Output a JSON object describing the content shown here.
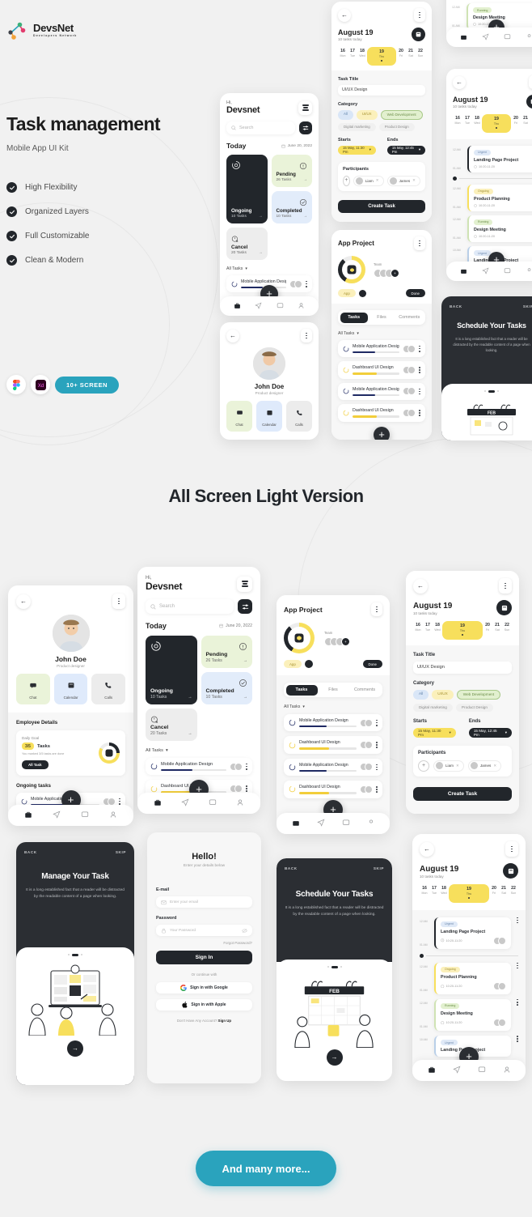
{
  "brand": {
    "name": "DevsNet",
    "tagline": "Developers Network"
  },
  "hero": {
    "title": "Task management",
    "subtitle": "Mobile App UI Kit",
    "features": [
      "High Flexibility",
      "Organized Layers",
      "Full Customizable",
      "Clean & Modern"
    ],
    "badges": {
      "figma": "Figma",
      "xd": "Xd",
      "screens": "10+ SCREEN"
    }
  },
  "section2": {
    "title": "All Screen Light Version"
  },
  "cta": {
    "label": "And many more..."
  },
  "home": {
    "greeting": "Hi,",
    "user": "Devsnet",
    "search_placeholder": "Search",
    "today_label": "Today",
    "today_date": "June 20, 2022",
    "stats": [
      {
        "name": "Ongoing",
        "count": "10 Tasks",
        "icon": "sync-icon"
      },
      {
        "name": "Pending",
        "count": "26 Tasks",
        "icon": "alert-icon"
      },
      {
        "name": "Completed",
        "count": "10 Tasks",
        "icon": "check-circle-icon"
      },
      {
        "name": "Cancel",
        "count": "20 Tasks",
        "icon": "clock-x-icon"
      }
    ],
    "all_tasks_label": "All Tasks",
    "tasks": [
      {
        "title": "Mobile Application Design",
        "progress": 48,
        "color": "#1f2a63"
      },
      {
        "title": "Dashboard UI Design",
        "progress": 52,
        "color": "#f2ce3b"
      }
    ]
  },
  "create_task": {
    "date": "August 19",
    "subtitle": "10 tasks today",
    "days": [
      {
        "n": "16",
        "w": "Mon"
      },
      {
        "n": "17",
        "w": "Tue"
      },
      {
        "n": "18",
        "w": "Wed"
      },
      {
        "n": "19",
        "w": "Thu"
      },
      {
        "n": "20",
        "w": "Fri"
      },
      {
        "n": "21",
        "w": "Sat"
      },
      {
        "n": "22",
        "w": "Sun"
      }
    ],
    "active_day_index": 3,
    "title_label": "Task Title",
    "title_value": "UI/UX Design",
    "category_label": "Category",
    "categories": [
      "All",
      "UI/UX",
      "Web Development",
      "Digital marketing",
      "Product Design"
    ],
    "starts_label": "Starts",
    "starts_value": "15 May, 11:30 Pm",
    "ends_label": "Ends",
    "ends_value": "15 May, 12:45 Pm",
    "participants_label": "Participants",
    "participants": [
      "Liam",
      "James"
    ],
    "submit": "Create Task"
  },
  "project": {
    "title": "App Project",
    "team_label": "Team",
    "team_more": "+",
    "tag": "App",
    "status": "Done",
    "tabs": [
      "Tasks",
      "Files",
      "Comments"
    ],
    "active_tab": 0,
    "all_tasks_label": "All Tasks",
    "tasks": [
      {
        "title": "Mobile Application Design",
        "progress": 48,
        "color": "#1f2a63"
      },
      {
        "title": "Dashboard UI Design",
        "progress": 52,
        "color": "#f2ce3b"
      },
      {
        "title": "Mobile Application Design",
        "progress": 48,
        "color": "#1f2a63"
      },
      {
        "title": "Dashboard UI Design",
        "progress": 52,
        "color": "#f2ce3b"
      }
    ]
  },
  "schedule": {
    "date": "August 19",
    "subtitle": "10 tasks today",
    "days": [
      {
        "n": "16",
        "w": "Mon"
      },
      {
        "n": "17",
        "w": "Tue"
      },
      {
        "n": "18",
        "w": "Wed"
      },
      {
        "n": "19",
        "w": "Thu"
      },
      {
        "n": "20",
        "w": "Fri"
      },
      {
        "n": "21",
        "w": "Sat"
      },
      {
        "n": "22",
        "w": "Sun"
      }
    ],
    "active_day_index": 3,
    "events": [
      {
        "tag": "Urgent",
        "tagType": "urgent",
        "name": "Landing Page Project",
        "time": "10:20-11:20",
        "start": "12 AM",
        "end": "01 AM",
        "accent": "#22262b"
      },
      {
        "tag": "Ongoing",
        "tagType": "ongoing",
        "name": "Product Planning",
        "time": "10:20-11:20",
        "start": "12 AM",
        "end": "01 AM",
        "accent": "#f7df5c"
      },
      {
        "tag": "Running",
        "tagType": "running",
        "name": "Design Meeting",
        "time": "10:20-11:20",
        "start": "12 AM",
        "end": "01 AM",
        "accent": "#cfe3b4"
      },
      {
        "tag": "Urgent",
        "tagType": "urgent",
        "name": "Landing Page Project",
        "time": "10:20-11:20",
        "start": "10 AM",
        "end": "11 AM",
        "accent": "#b9cfe8"
      }
    ]
  },
  "profile": {
    "name": "John Doe",
    "role": "Product designer",
    "actions": [
      {
        "label": "Chat",
        "icon": "chat-icon"
      },
      {
        "label": "Calendar",
        "icon": "calendar-icon"
      },
      {
        "label": "Calls",
        "icon": "phone-icon"
      }
    ],
    "details_title": "Employee Details",
    "goal_label": "Daily Goal",
    "goal_count": "3/5",
    "goal_word": "Tasks",
    "goal_desc": "You marked 3/5 tasks are done",
    "goal_btn": "All Task",
    "ongoing_title": "Ongoing tasks",
    "ongoing_task": {
      "title": "Mobile Application Design",
      "progress": 48,
      "color": "#1f2a63"
    }
  },
  "onboarding_manage": {
    "back": "BACK",
    "skip": "SKIP",
    "title": "Manage Your Task",
    "body": "It is a long established fact that a reader will be distracted by the readable content of a page when looking."
  },
  "onboarding_schedule": {
    "back": "BACK",
    "skip": "SKIP",
    "title": "Schedule Your Tasks",
    "body": "It is a long established fact that a reader will be distracted by the readable content of a page when looking.",
    "art_label": "FEB"
  },
  "login": {
    "title": "Hello!",
    "subtitle": "Enter your details below",
    "email_label": "E-mail",
    "email_placeholder": "Enter your email",
    "password_label": "Password",
    "password_placeholder": "Your Password",
    "forgot": "Forgot Password?",
    "signin": "Sign In",
    "or": "Or continue with",
    "google": "Sign in with Google",
    "apple": "Sign in with Apple",
    "footer": "Don't Have Any Account?",
    "footer_link": "Sign Up"
  },
  "colors": {
    "dark": "#22262b",
    "yellow": "#f7df5c",
    "teal": "#2aa3bd",
    "green_card": "#eaf3d9",
    "blue_card": "#e2ecfa"
  }
}
